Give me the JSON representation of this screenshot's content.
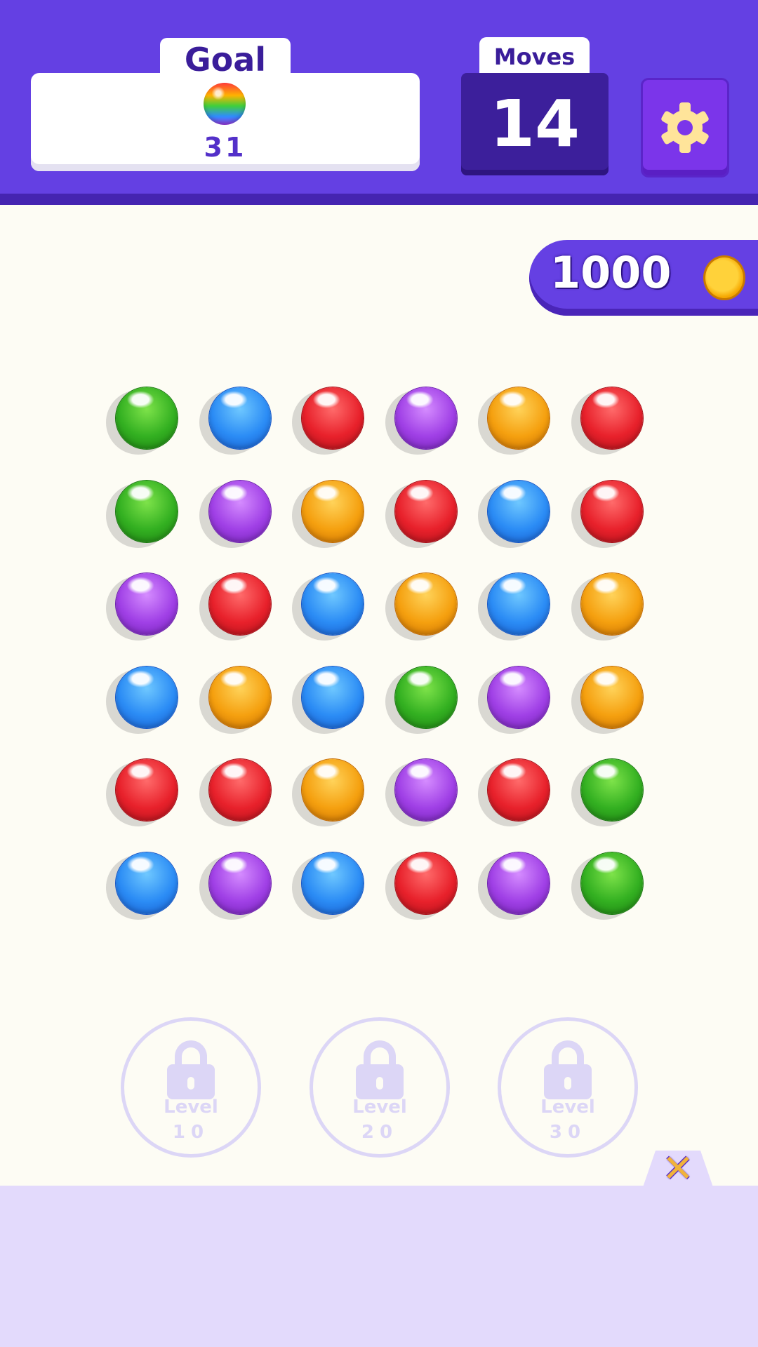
{
  "header": {
    "goal_label": "Goal",
    "goal_count": "31",
    "goal_icon": "rainbow-ball-icon",
    "moves_label": "Moves",
    "moves_value": "14",
    "settings_icon": "gear-icon"
  },
  "coins": {
    "value": "1000",
    "icon": "coin-icon"
  },
  "board": {
    "rows": [
      [
        "green",
        "blue",
        "red",
        "purple",
        "orange",
        "red"
      ],
      [
        "green",
        "purple",
        "orange",
        "red",
        "blue",
        "red"
      ],
      [
        "purple",
        "red",
        "blue",
        "orange",
        "blue",
        "orange"
      ],
      [
        "blue",
        "orange",
        "blue",
        "green",
        "purple",
        "orange"
      ],
      [
        "red",
        "red",
        "orange",
        "purple",
        "red",
        "green"
      ],
      [
        "blue",
        "purple",
        "blue",
        "red",
        "purple",
        "green"
      ]
    ],
    "palette": {
      "green": [
        "#7ee34a",
        "#33b021",
        "#1a7a10"
      ],
      "blue": [
        "#6fc8ff",
        "#2b8cf5",
        "#1556c8"
      ],
      "red": [
        "#ff6b6b",
        "#e8212b",
        "#a80f18"
      ],
      "purple": [
        "#d58cff",
        "#a040e6",
        "#6e1fb0"
      ],
      "orange": [
        "#ffd35a",
        "#f5a00f",
        "#c46a00"
      ]
    }
  },
  "locks": [
    {
      "label": "Level",
      "number": "10"
    },
    {
      "label": "Level",
      "number": "20"
    },
    {
      "label": "Level",
      "number": "30"
    }
  ],
  "close_icon": "close-icon",
  "colors": {
    "header": "#6440e3",
    "background": "#fdfcf4",
    "panel": "#e3dafc"
  }
}
